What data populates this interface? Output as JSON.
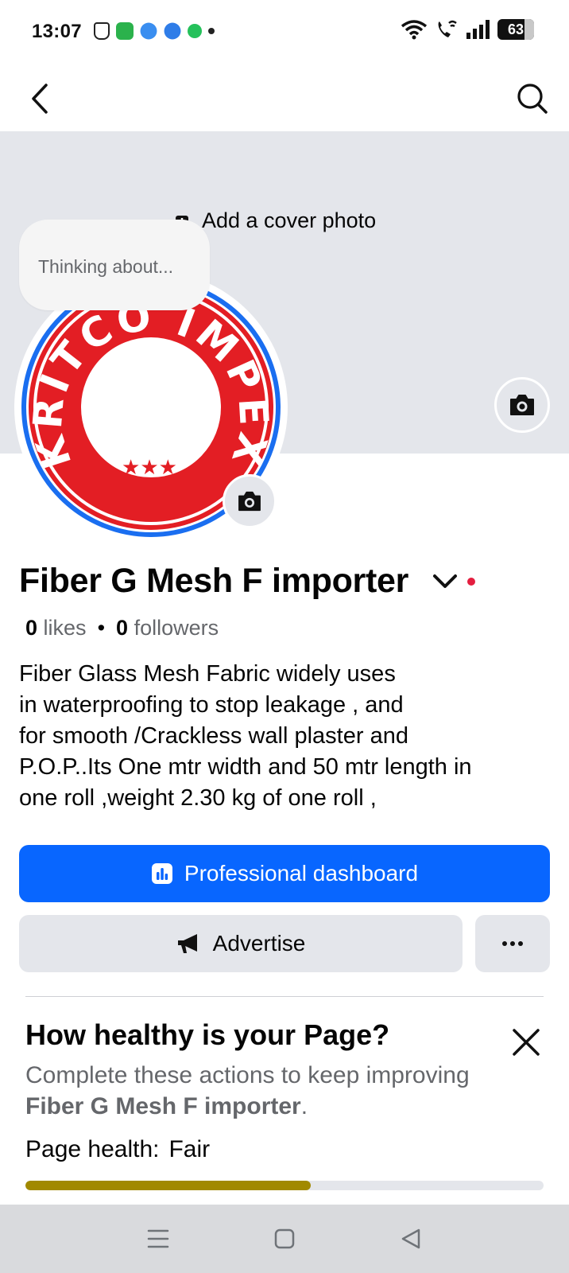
{
  "status_bar": {
    "time": "13:07",
    "battery": "63",
    "icons": [
      "finger-tap-icon",
      "app-green-icon",
      "app-blue-icon",
      "app-blue-icon",
      "chat-green-icon",
      "dot-icon",
      "wifi-icon",
      "wifi-call-icon",
      "signal-icon",
      "battery-icon"
    ]
  },
  "top_bar": {
    "back_icon": "chevron-left-icon",
    "search_icon": "search-icon"
  },
  "cover": {
    "add_cover_label": "Add a cover photo"
  },
  "thinking_bubble": "Thinking about...",
  "profile": {
    "logo_text_top": "KRITCO IMPEX",
    "logo_stars": "★★★",
    "colors": {
      "logo_red": "#e31e24",
      "logo_blue": "#1a6ef0"
    }
  },
  "page": {
    "name": "Fiber G Mesh F importer",
    "likes_count": "0",
    "likes_label": "likes",
    "followers_count": "0",
    "followers_label": "followers",
    "bio": "Fiber Glass Mesh Fabric widely uses\nin waterproofing to stop leakage , and\nfor smooth /Crackless wall plaster  and\nP.O.P..Its  One mtr width and 50 mtr length in\none roll ,weight 2.30 kg of one roll ,"
  },
  "actions": {
    "professional_dashboard": "Professional dashboard",
    "advertise": "Advertise",
    "more": "..."
  },
  "health": {
    "title": "How healthy is your Page?",
    "desc_prefix": "Complete these actions to keep improving ",
    "desc_page": "Fiber G Mesh F importer",
    "desc_suffix": ".",
    "status_label": "Page health:",
    "status_value": "Fair",
    "progress": 0.55,
    "progress_color": "#a18900"
  },
  "colors": {
    "primary": "#0866ff",
    "secondary_bg": "#e4e6eb",
    "muted_text": "#65676b",
    "notification_dot": "#e41e3f"
  }
}
